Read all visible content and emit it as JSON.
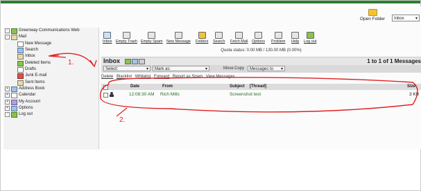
{
  "open_folder": {
    "label": "Open Folder",
    "value": "Inbox"
  },
  "sidebar": {
    "items": [
      {
        "label": "Greenway Communications Web",
        "icon": "green-app-icon"
      },
      {
        "label": "Mail",
        "icon": "folder-icon"
      },
      {
        "label": "New Message",
        "icon": "new-message-icon"
      },
      {
        "label": "Search",
        "icon": "search-icon"
      },
      {
        "label": "Inbox",
        "icon": "inbox-icon"
      },
      {
        "label": "Deleted Items",
        "icon": "trash-icon"
      },
      {
        "label": "Drafts",
        "icon": "drafts-icon"
      },
      {
        "label": "Junk E-mail",
        "icon": "junk-icon"
      },
      {
        "label": "Sent Items",
        "icon": "sent-icon"
      },
      {
        "label": "Address Book",
        "icon": "address-book-icon"
      },
      {
        "label": "Calendar",
        "icon": "calendar-icon"
      },
      {
        "label": "My Account",
        "icon": "account-icon"
      },
      {
        "label": "Options",
        "icon": "options-icon"
      },
      {
        "label": "Log out",
        "icon": "logout-icon"
      }
    ]
  },
  "toolbar": {
    "items": [
      {
        "label": "Inbox",
        "icon": "inbox-icon"
      },
      {
        "label": "Empty Trash",
        "icon": "empty-trash-icon"
      },
      {
        "label": "Empty Spam",
        "icon": "empty-spam-icon"
      },
      {
        "label": "New Message",
        "icon": "new-message-icon"
      },
      {
        "label": "Folders",
        "icon": "folders-icon"
      },
      {
        "label": "Search",
        "icon": "search-icon"
      },
      {
        "label": "Fetch Mail",
        "icon": "fetch-mail-icon"
      },
      {
        "label": "Options",
        "icon": "options-icon"
      },
      {
        "label": "Problem",
        "icon": "problem-icon"
      },
      {
        "label": "Help",
        "icon": "help-icon"
      },
      {
        "label": "Log out",
        "icon": "logout-icon"
      }
    ],
    "quota": "Quota status: 0.00 MB / 130.00 MB (0.00%)"
  },
  "inbox": {
    "title": "Inbox",
    "count": "1 to 1 of 1 Messages",
    "select_label": "Select:",
    "mark_as_label": "Mark as:",
    "move_label": "Move",
    "copy_label": "Copy",
    "messages_to_label": "Messages to",
    "actions": [
      "Delete",
      "Blacklist",
      "Whitelist",
      "Forward",
      "Report as Spam",
      "View Messages"
    ],
    "columns": {
      "date": "Date",
      "from": "From",
      "subject": "Subject",
      "thread": "[Thread]",
      "size": "Size"
    },
    "rows": [
      {
        "date": "12:08:30 AM",
        "from": "Rich Mills",
        "subject": "Screenshot test",
        "size": "3 KB"
      }
    ]
  },
  "annotations": {
    "label_1": "1.",
    "label_2": "2."
  },
  "colors": {
    "accent_green": "#2e7d32",
    "annotation_red": "#e02020",
    "link_green": "#2a6a2a"
  }
}
